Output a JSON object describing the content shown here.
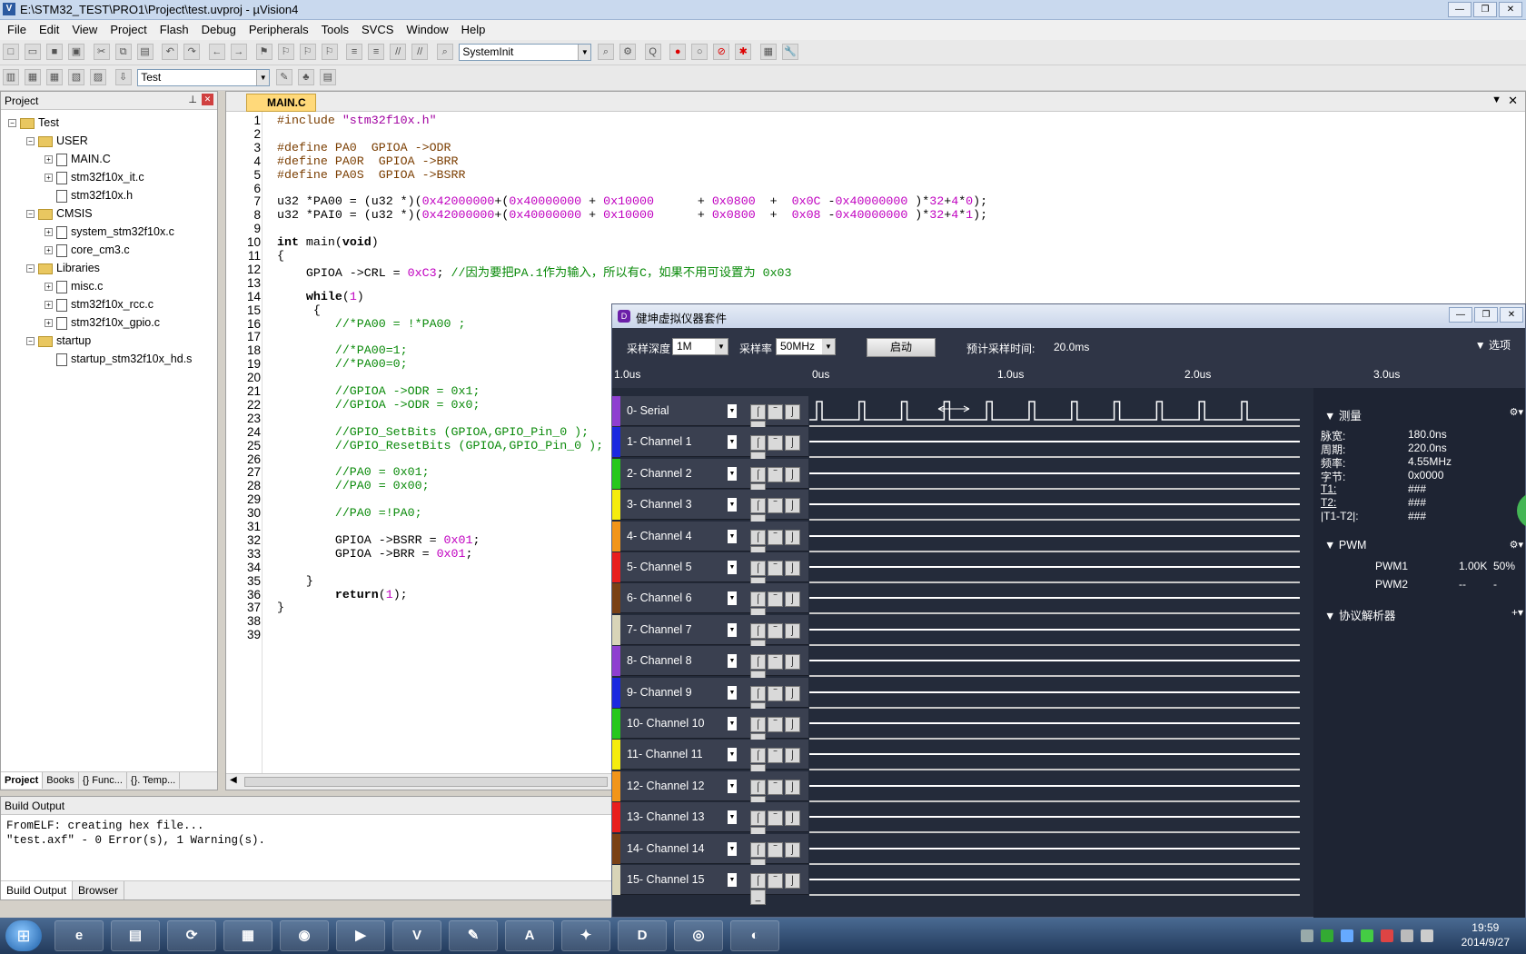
{
  "window": {
    "title": "E:\\STM32_TEST\\PRO1\\Project\\test.uvproj - µVision4"
  },
  "menu": [
    "File",
    "Edit",
    "View",
    "Project",
    "Flash",
    "Debug",
    "Peripherals",
    "Tools",
    "SVCS",
    "Window",
    "Help"
  ],
  "toolbar": {
    "function_combo": "SystemInit",
    "target_combo": "Test"
  },
  "project_panel": {
    "title": "Project",
    "tree": [
      {
        "label": "Test",
        "level": 0,
        "kind": "root"
      },
      {
        "label": "USER",
        "level": 1,
        "kind": "folder"
      },
      {
        "label": "MAIN.C",
        "level": 2,
        "kind": "file"
      },
      {
        "label": "stm32f10x_it.c",
        "level": 2,
        "kind": "file"
      },
      {
        "label": "stm32f10x.h",
        "level": 2,
        "kind": "file"
      },
      {
        "label": "CMSIS",
        "level": 1,
        "kind": "folder"
      },
      {
        "label": "system_stm32f10x.c",
        "level": 2,
        "kind": "file"
      },
      {
        "label": "core_cm3.c",
        "level": 2,
        "kind": "file"
      },
      {
        "label": "Libraries",
        "level": 1,
        "kind": "folder"
      },
      {
        "label": "misc.c",
        "level": 2,
        "kind": "file"
      },
      {
        "label": "stm32f10x_rcc.c",
        "level": 2,
        "kind": "file"
      },
      {
        "label": "stm32f10x_gpio.c",
        "level": 2,
        "kind": "file"
      },
      {
        "label": "startup",
        "level": 1,
        "kind": "folder"
      },
      {
        "label": "startup_stm32f10x_hd.s",
        "level": 2,
        "kind": "file"
      }
    ],
    "tabs": [
      "Project",
      "Books",
      "{} Func...",
      "{}. Temp..."
    ]
  },
  "editor": {
    "tab": "MAIN.C",
    "lines": [
      "#include \"stm32f10x.h\"",
      "",
      "#define PA0  GPIOA ->ODR",
      "#define PA0R  GPIOA ->BRR",
      "#define PA0S  GPIOA ->BSRR",
      "",
      "u32 *PA00 = (u32 *)(0x42000000+(0x40000000 + 0x10000      + 0x0800  +  0x0C -0x40000000 )*32+4*0);",
      "u32 *PAI0 = (u32 *)(0x42000000+(0x40000000 + 0x10000      + 0x0800  +  0x08 -0x40000000 )*32+4*1);",
      "",
      "int main(void)",
      "{",
      "    GPIOA ->CRL = 0xC3; //因为要把PA.1作为输入，所以有C，如果不用可设置为 0x03",
      "",
      "    while(1)",
      "     {",
      "        //*PA00 = !*PA00 ;",
      "",
      "        //*PA00=1;",
      "        //*PA00=0;",
      "",
      "        //GPIOA ->ODR = 0x1;",
      "        //GPIOA ->ODR = 0x0;",
      "",
      "        //GPIO_SetBits (GPIOA,GPIO_Pin_0 );",
      "        //GPIO_ResetBits (GPIOA,GPIO_Pin_0 );",
      "",
      "        //PA0 = 0x01;",
      "        //PA0 = 0x00;",
      "",
      "        //PA0 =!PA0;",
      "",
      "        GPIOA ->BSRR = 0x01;",
      "        GPIOA ->BRR = 0x01;",
      "",
      "    }",
      "        return(1);",
      "}",
      "",
      ""
    ]
  },
  "build_output": {
    "title": "Build Output",
    "text": "FromELF: creating hex file...\n\"test.axf\" - 0 Error(s), 1 Warning(s).",
    "tabs": [
      "Build Output",
      "Browser"
    ]
  },
  "analyzer": {
    "title": "健坤虚拟仪器套件",
    "depth_label": "采样深度",
    "depth_value": "1M",
    "rate_label": "采样率",
    "rate_value": "50MHz",
    "start_button": "启动",
    "est_label": "预计采样时间:",
    "est_value": "20.0ms",
    "options_label": "选项",
    "ruler": [
      "1.0us",
      "0us",
      "1.0us",
      "2.0us",
      "3.0us"
    ],
    "channels": [
      {
        "name": "0- Serial",
        "color": "#8e3fd0"
      },
      {
        "name": "1- Channel 1",
        "color": "#1a28e0"
      },
      {
        "name": "2- Channel 2",
        "color": "#27c81c"
      },
      {
        "name": "3- Channel 3",
        "color": "#f5ec0e"
      },
      {
        "name": "4- Channel 4",
        "color": "#f2951a"
      },
      {
        "name": "5- Channel 5",
        "color": "#e81e1e"
      },
      {
        "name": "6- Channel 6",
        "color": "#7a4116"
      },
      {
        "name": "7- Channel 7",
        "color": "#d8d4b8"
      },
      {
        "name": "8- Channel 8",
        "color": "#8e3fd0"
      },
      {
        "name": "9- Channel 9",
        "color": "#1a28e0"
      },
      {
        "name": "10- Channel 10",
        "color": "#27c81c"
      },
      {
        "name": "11- Channel 11",
        "color": "#f5ec0e"
      },
      {
        "name": "12- Channel 12",
        "color": "#f2951a"
      },
      {
        "name": "13- Channel 13",
        "color": "#e81e1e"
      },
      {
        "name": "14- Channel 14",
        "color": "#7a4116"
      },
      {
        "name": "15- Channel 15",
        "color": "#d8d4b8"
      }
    ],
    "measure": {
      "title": "测量",
      "rows": [
        {
          "k": "脉宽:",
          "v": "180.0ns"
        },
        {
          "k": "周期:",
          "v": "220.0ns"
        },
        {
          "k": "频率:",
          "v": "4.55MHz"
        },
        {
          "k": "字节:",
          "v": "0x0000"
        },
        {
          "k": "T1:",
          "v": "###"
        },
        {
          "k": "T2:",
          "v": "###"
        },
        {
          "k": "|T1-T2|:",
          "v": "###"
        }
      ]
    },
    "pwm": {
      "title": "PWM",
      "rows": [
        {
          "name": "PWM1",
          "freq": "1.00K",
          "duty": "50%"
        },
        {
          "name": "PWM2",
          "freq": "--",
          "duty": "-"
        }
      ]
    },
    "protocol": {
      "title": "协议解析器"
    }
  },
  "taskbar": {
    "time": "19:59",
    "date": "2014/9/27"
  }
}
